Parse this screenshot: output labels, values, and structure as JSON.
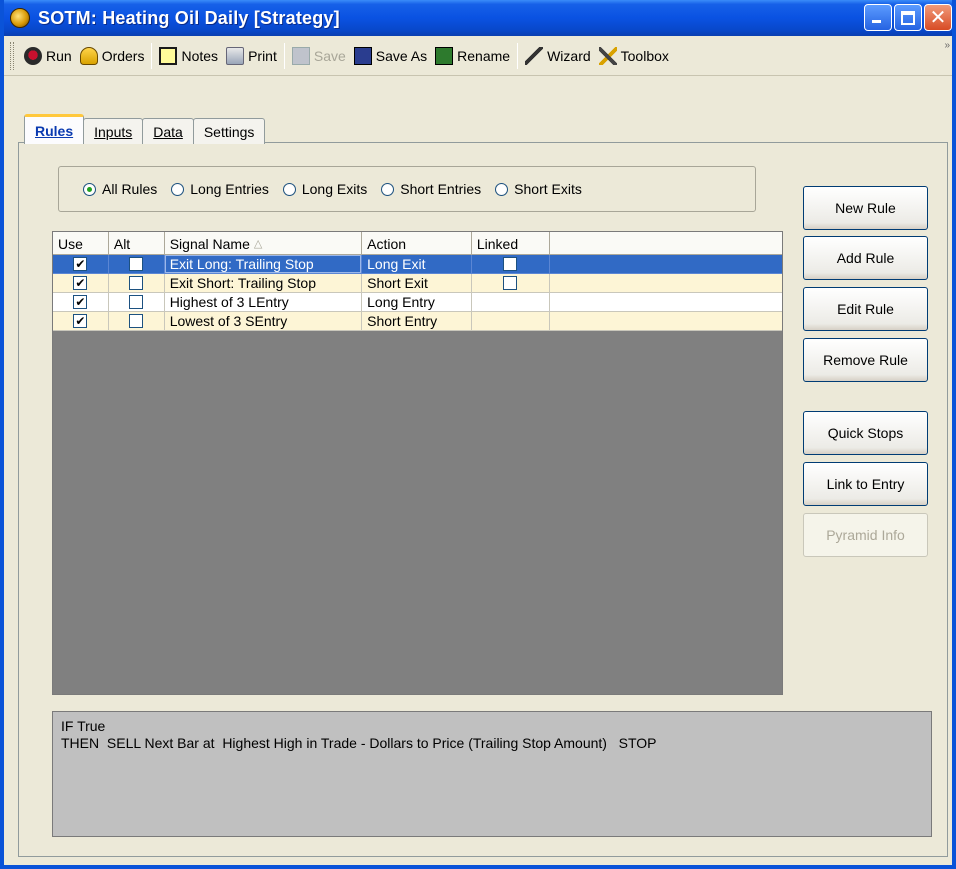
{
  "window": {
    "title": "SOTM: Heating Oil Daily   [Strategy]"
  },
  "toolbar": {
    "run": "Run",
    "orders": "Orders",
    "notes": "Notes",
    "print": "Print",
    "save": "Save",
    "save_as": "Save As",
    "rename": "Rename",
    "wizard": "Wizard",
    "toolbox": "Toolbox",
    "overflow": "»"
  },
  "tabs": [
    "Rules",
    "Inputs",
    "Data",
    "Settings"
  ],
  "filters": {
    "options": [
      "All Rules",
      "Long Entries",
      "Long Exits",
      "Short Entries",
      "Short Exits"
    ],
    "selected": "All Rules"
  },
  "grid": {
    "headers": [
      "Use",
      "Alt",
      "Signal Name",
      "Action",
      "Linked"
    ],
    "sort_column": "Signal Name",
    "rows": [
      {
        "use": true,
        "alt": false,
        "name": "Exit Long: Trailing Stop",
        "action": "Long Exit",
        "linked": false,
        "selected": true
      },
      {
        "use": true,
        "alt": false,
        "name": "Exit Short: Trailing Stop",
        "action": "Short Exit",
        "linked": false,
        "selected": false
      },
      {
        "use": true,
        "alt": false,
        "name": "Highest of 3 LEntry",
        "action": "Long Entry",
        "linked": null,
        "selected": false
      },
      {
        "use": true,
        "alt": false,
        "name": "Lowest of 3 SEntry",
        "action": "Short Entry",
        "linked": null,
        "selected": false
      }
    ]
  },
  "buttons": {
    "new_rule": "New Rule",
    "add_rule": "Add Rule",
    "edit_rule": "Edit Rule",
    "remove_rule": "Remove Rule",
    "quick_stops": "Quick Stops",
    "link_to_entry": "Link to Entry",
    "pyramid_info": "Pyramid Info"
  },
  "description": {
    "line1": "IF True",
    "line2": "THEN  SELL Next Bar at  Highest High in Trade - Dollars to Price (Trailing Stop Amount)   STOP"
  },
  "colors": {
    "title_blue": "#0a52e2",
    "selection": "#316ac5",
    "row_cream": "#fdf5d6",
    "grid_bg": "#808080",
    "desc_bg": "#c0c0c0"
  }
}
